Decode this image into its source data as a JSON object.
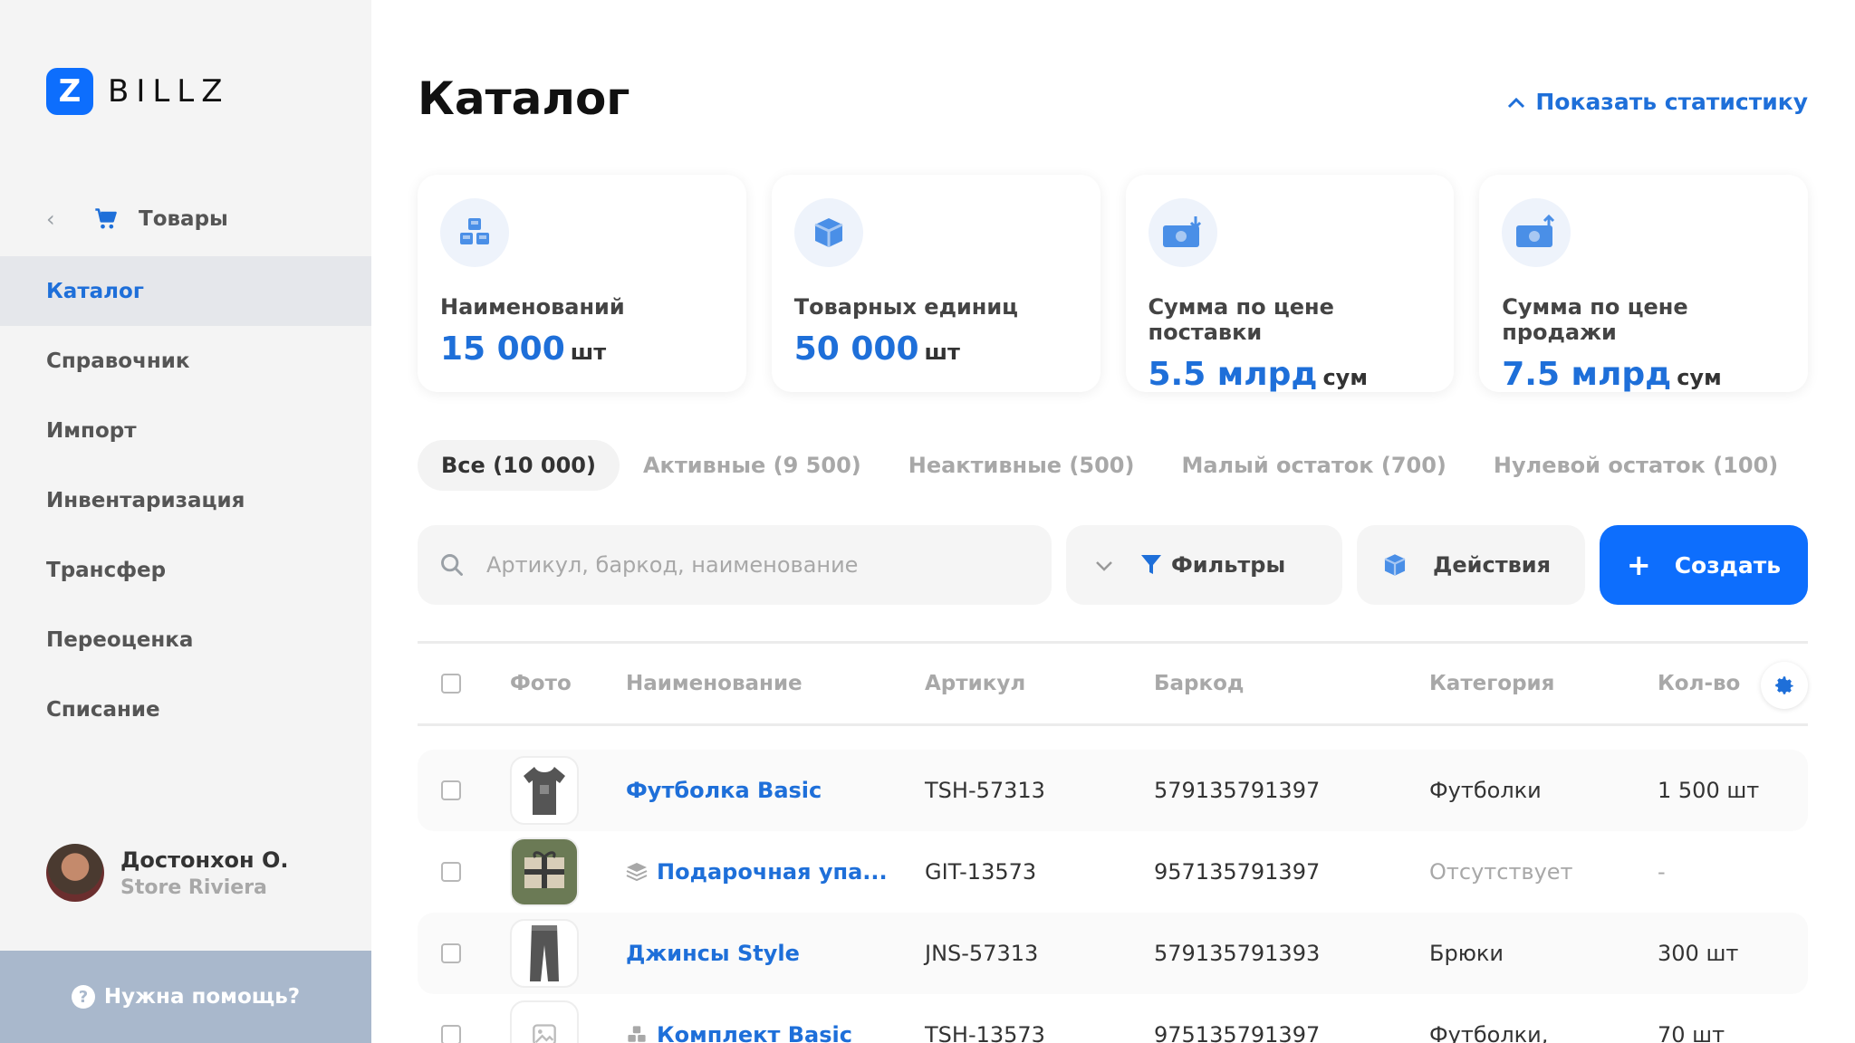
{
  "brand": {
    "logo_mark": "Z",
    "name": "BILLZ",
    "accent": "#0d6efd"
  },
  "sidebar": {
    "section": "Товары",
    "items": [
      {
        "label": "Каталог",
        "active": true
      },
      {
        "label": "Справочник"
      },
      {
        "label": "Импорт"
      },
      {
        "label": "Инвентаризация"
      },
      {
        "label": "Трансфер"
      },
      {
        "label": "Переоценка"
      },
      {
        "label": "Списание"
      }
    ],
    "user": {
      "name": "Достонхон О.",
      "store": "Store Riviera"
    },
    "help": "Нужна помощь?"
  },
  "header": {
    "title": "Каталог",
    "stats_toggle": "Показать статистику"
  },
  "cards": [
    {
      "icon": "cubes-icon",
      "label": "Наименований",
      "value": "15 000",
      "unit": "шт"
    },
    {
      "icon": "box-icon",
      "label": "Товарных единиц",
      "value": "50 000",
      "unit": "шт"
    },
    {
      "icon": "money-in-icon",
      "label": "Сумма по цене поставки",
      "value": "5.5 млрд",
      "unit": "сум"
    },
    {
      "icon": "money-out-icon",
      "label": "Сумма по цене продажи",
      "value": "7.5 млрд",
      "unit": "сум"
    }
  ],
  "tabs": [
    {
      "label": "Все (10 000)",
      "active": true
    },
    {
      "label": "Активные (9 500)"
    },
    {
      "label": "Неактивные (500)"
    },
    {
      "label": "Малый остаток (700)"
    },
    {
      "label": "Нулевой остаток (100)"
    }
  ],
  "toolbar": {
    "search_placeholder": "Артикул, баркод, наименование",
    "filters": "Фильтры",
    "actions": "Действия",
    "create": "Создать"
  },
  "table": {
    "columns": [
      "Фото",
      "Наименование",
      "Артикул",
      "Баркод",
      "Категория",
      "Кол-во"
    ],
    "rows": [
      {
        "name": "Футболка Basic",
        "article": "TSH-57313",
        "barcode": "579135791397",
        "category": "Футболки",
        "qty": "1 500 шт",
        "photo": "tshirt"
      },
      {
        "name": "Подарочная упа...",
        "article": "GIT-13573",
        "barcode": "957135791397",
        "category": "Отсутствует",
        "qty": "-",
        "photo": "gift",
        "stack": true
      },
      {
        "name": "Джинсы Style",
        "article": "JNS-57313",
        "barcode": "579135791393",
        "category": "Брюки",
        "qty": "300 шт",
        "photo": "jeans"
      },
      {
        "name": "Комплект Basic",
        "article": "TSH-13573",
        "barcode": "975135791397",
        "category": "Футболки,",
        "qty": "70 шт",
        "photo": "placeholder",
        "kit": true
      }
    ]
  }
}
